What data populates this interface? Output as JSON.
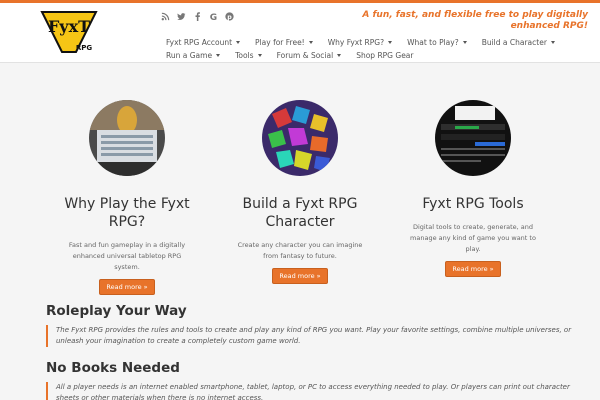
{
  "header": {
    "tagline": "A fun, fast, and flexible free to play digitally enhanced RPG!",
    "logo_text": "FyxT RPG",
    "social_icons": [
      "rss-icon",
      "twitter-icon",
      "facebook-icon",
      "google-icon",
      "pinterest-icon"
    ]
  },
  "nav": {
    "row1": [
      "Fyxt RPG Account",
      "Play for Free!",
      "Why Fyxt RPG?",
      "What to Play?",
      "Build a Character"
    ],
    "row2": [
      "Run a Game",
      "Tools",
      "Forum & Social",
      "Shop RPG Gear"
    ],
    "row2_caret": [
      true,
      true,
      true,
      false
    ]
  },
  "features": [
    {
      "title": "Why Play the Fyxt RPG?",
      "text": "Fast and fun gameplay in a digitally enhanced universal tabletop RPG system.",
      "button": "Read more »"
    },
    {
      "title": "Build a Fyxt RPG Character",
      "text": "Create any character you can imagine from fantasy to future.",
      "button": "Read more »"
    },
    {
      "title": "Fyxt RPG Tools",
      "text": "Digital tools to create, generate, and manage any kind of game you want to play.",
      "button": "Read more »"
    }
  ],
  "sections": [
    {
      "heading": "Roleplay Your Way",
      "quote": "The Fyxt RPG provides the rules and tools to create and play any kind of RPG you want. Play your favorite settings, combine multiple universes, or unleash your imagination to create a completely custom game world."
    },
    {
      "heading": "No Books Needed",
      "quote": "All a player needs is an internet enabled smartphone, tablet, laptop, or PC to access everything needed to play. Or players can print out character sheets or other materials when there is no internet access."
    }
  ],
  "colors": {
    "accent": "#e8732a",
    "logo_yellow": "#f6c515"
  }
}
